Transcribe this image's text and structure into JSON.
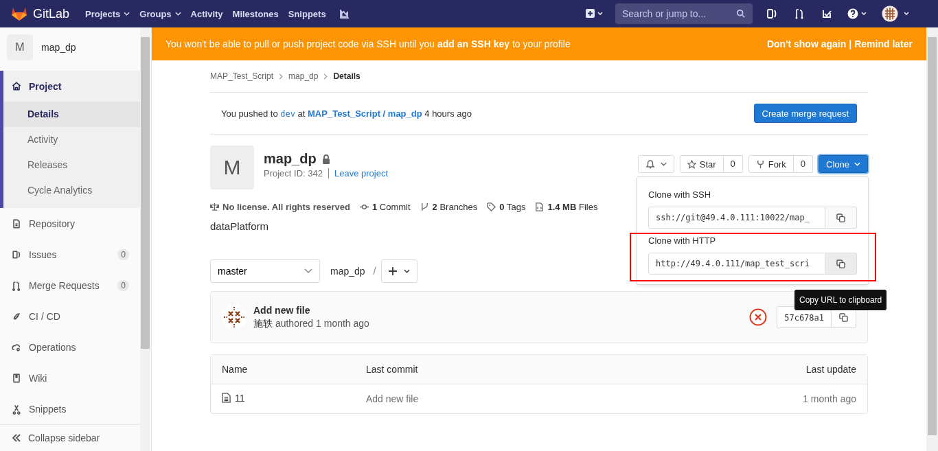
{
  "navbar": {
    "brand": "GitLab",
    "links": [
      {
        "label": "Projects",
        "dropdown": true
      },
      {
        "label": "Groups",
        "dropdown": true
      },
      {
        "label": "Activity",
        "dropdown": false
      },
      {
        "label": "Milestones",
        "dropdown": false
      },
      {
        "label": "Snippets",
        "dropdown": false
      }
    ],
    "search": {
      "placeholder": "Search or jump to..."
    }
  },
  "sidebar": {
    "project_letter": "M",
    "project_name": "map_dp",
    "items": [
      {
        "label": "Project",
        "selected": true,
        "children": [
          {
            "label": "Details",
            "selected": true
          },
          {
            "label": "Activity",
            "selected": false
          },
          {
            "label": "Releases",
            "selected": false
          },
          {
            "label": "Cycle Analytics",
            "selected": false
          }
        ]
      },
      {
        "label": "Repository",
        "selected": false
      },
      {
        "label": "Issues",
        "selected": false,
        "count": "0"
      },
      {
        "label": "Merge Requests",
        "selected": false,
        "count": "0"
      },
      {
        "label": "CI / CD",
        "selected": false
      },
      {
        "label": "Operations",
        "selected": false
      },
      {
        "label": "Wiki",
        "selected": false
      },
      {
        "label": "Snippets",
        "selected": false
      }
    ],
    "collapse": "Collapse sidebar"
  },
  "banner": {
    "text": "You won't be able to pull or push project code via SSH until you **add an SSH key** to your profile",
    "actions": [
      "Don't show again",
      "Remind later"
    ],
    "separator": "|"
  },
  "breadcrumbs": [
    "MAP_Test_Script",
    "map_dp",
    "Details"
  ],
  "push_notice": {
    "prefix": "You pushed to",
    "branch": "dev",
    "middle": "at",
    "project": "MAP_Test_Script / map_dp",
    "suffix": "4 hours ago",
    "button": "Create merge request"
  },
  "project": {
    "letter": "M",
    "name": "map_dp",
    "private": true,
    "id_text": "Project ID: 342",
    "leave": "Leave project",
    "description": "dataPlatform",
    "stats": [
      {
        "kind": "license",
        "value": "No license. All rights reserved"
      },
      {
        "kind": "commit",
        "value": "1",
        "label": "Commit"
      },
      {
        "kind": "branch",
        "value": "2",
        "label": "Branches"
      },
      {
        "kind": "tag",
        "value": "0",
        "label": "Tags"
      },
      {
        "kind": "files",
        "value": "1.4 MB",
        "label": "Files"
      }
    ]
  },
  "actions": {
    "star": {
      "label": "Star",
      "count": "0"
    },
    "fork": {
      "label": "Fork",
      "count": "0"
    },
    "clone": {
      "label": "Clone",
      "expanded": true
    }
  },
  "clone_options": [
    {
      "title": "Clone with SSH",
      "url": "ssh://git@49.4.0.111:10022/map_",
      "highlighted": false
    },
    {
      "title": "Clone with HTTP",
      "url": "http://49.4.0.111/map_test_scri",
      "highlighted": true
    }
  ],
  "tooltip": "Copy URL to clipboard",
  "tree": {
    "branch": "master",
    "path": "map_dp",
    "separator": "/"
  },
  "last_commit": {
    "title": "Add new file",
    "author": "施轶",
    "meta": "authored 1 month ago",
    "sha": "57c678a1"
  },
  "files": {
    "columns": [
      "Name",
      "Last commit",
      "Last update"
    ],
    "rows": [
      {
        "name": "11",
        "commit": "Add new file",
        "updated": "1 month ago"
      }
    ]
  }
}
